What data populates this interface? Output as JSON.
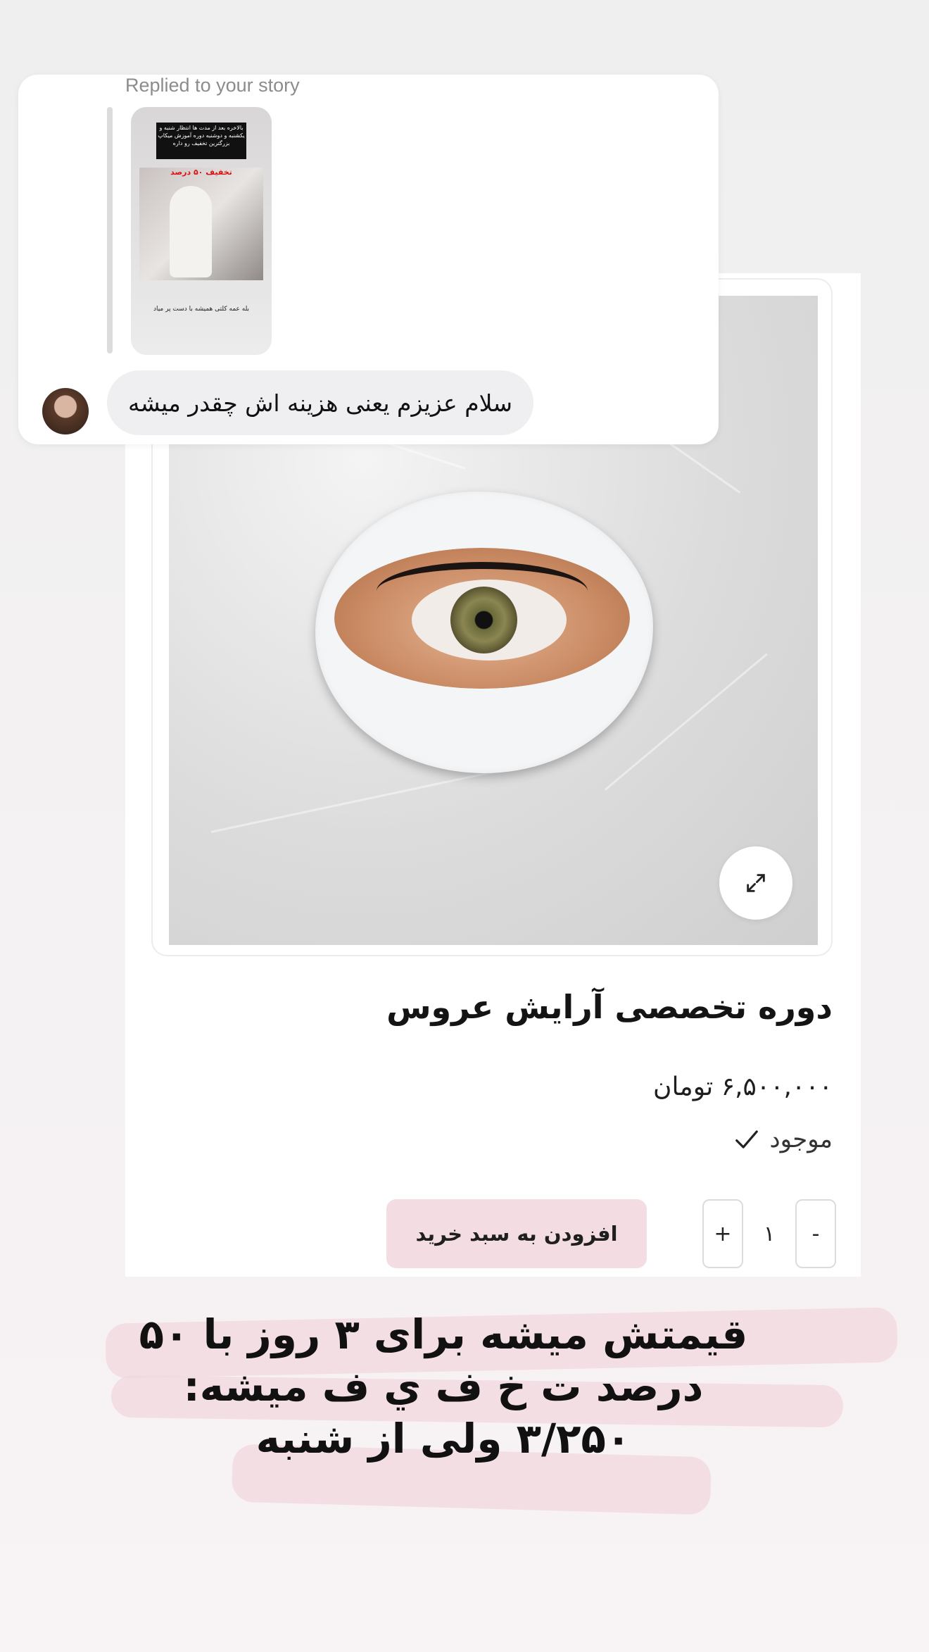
{
  "story_reply": {
    "replied_label": "Replied to your story",
    "thumbnail": {
      "banner_text": "بالاخره بعد از مدت ها انتظار شنبه و یکشنبه و دوشنبه دوره آموزش میکاپ بزرگترین تخفیف رو داره",
      "sale_text": "تخفیف ۵۰ درصد",
      "caption": "بله عمه کلتی همیشه با دست پر میاد"
    },
    "message": "سلام عزیزم یعنی هزینه اش چقدر میشه"
  },
  "product": {
    "title": "دوره تخصصی آرایش عروس",
    "price": "۶,۵۰۰,۰۰۰ تومان",
    "stock": "موجود",
    "quantity": "۱",
    "minus_label": "-",
    "plus_label": "+",
    "add_to_cart_label": "افزودن به سبد خرید",
    "expand_icon": "expand-icon"
  },
  "caption": {
    "line1": "قیمتش میشه برای ۳ روز با ۵۰",
    "line2": "درصد ت خ ف ي ف میشه:",
    "line3": "۳/۲۵۰  ولی از شنبه"
  },
  "colors": {
    "cart_button": "#f3dde3",
    "highlight": "#f2d7df",
    "bubble": "#efeff1"
  }
}
